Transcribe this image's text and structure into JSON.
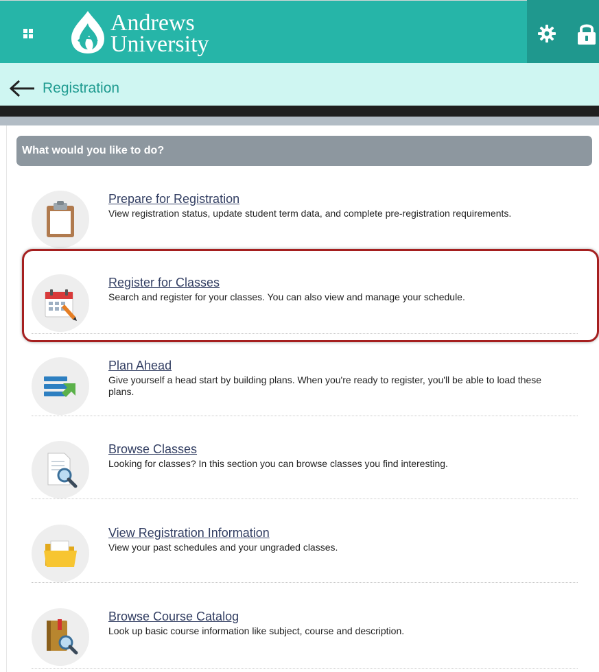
{
  "header": {
    "logo_line1": "Andrews",
    "logo_line2": "University",
    "icons": [
      "apps-grid-icon",
      "andrews-flame-logo-icon",
      "gear-icon",
      "lock-icon"
    ],
    "colors": {
      "brand_teal": "#26b5a8",
      "brand_teal_dark": "#1f988e",
      "subbar": "#cff6f2"
    }
  },
  "breadcrumb": {
    "title": "Registration"
  },
  "panel": {
    "heading": "What would you like to do?"
  },
  "items": [
    {
      "title": "Prepare for Registration",
      "description": "View registration status, update student term data, and complete pre-registration requirements.",
      "icon": "clipboard-icon"
    },
    {
      "title": "Register for Classes",
      "description": "Search and register for your classes. You can also view and manage your schedule.",
      "icon": "calendar-pencil-icon",
      "highlighted": true
    },
    {
      "title": "Plan Ahead",
      "description": "Give yourself a head start by building plans. When you're ready to register, you'll be able to load these plans.",
      "icon": "plan-list-arrow-icon"
    },
    {
      "title": "Browse Classes",
      "description": "Looking for classes? In this section you can browse classes you find interesting.",
      "icon": "document-magnifier-icon"
    },
    {
      "title": "View Registration Information",
      "description": "View your past schedules and your ungraded classes.",
      "icon": "folder-icon"
    },
    {
      "title": "Browse Course Catalog",
      "description": "Look up basic course information like subject, course and description.",
      "icon": "book-magnifier-icon"
    }
  ]
}
